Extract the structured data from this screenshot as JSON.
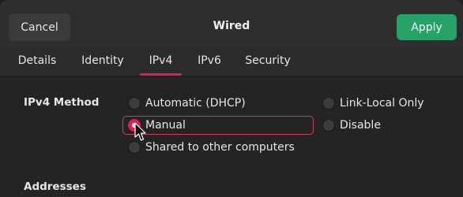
{
  "header": {
    "cancel_label": "Cancel",
    "title": "Wired",
    "apply_label": "Apply"
  },
  "tabs": [
    {
      "label": "Details",
      "active": false
    },
    {
      "label": "Identity",
      "active": false
    },
    {
      "label": "IPv4",
      "active": true
    },
    {
      "label": "IPv6",
      "active": false
    },
    {
      "label": "Security",
      "active": false
    }
  ],
  "ipv4": {
    "method_label": "IPv4 Method",
    "options": [
      {
        "label": "Automatic (DHCP)",
        "checked": false
      },
      {
        "label": "Manual",
        "checked": true
      },
      {
        "label": "Shared to other computers",
        "checked": false
      },
      {
        "label": "Link-Local Only",
        "checked": false
      },
      {
        "label": "Disable",
        "checked": false
      }
    ],
    "addresses_label": "Addresses"
  },
  "colors": {
    "accent": "#e01b5a",
    "apply_green": "#26a269"
  }
}
